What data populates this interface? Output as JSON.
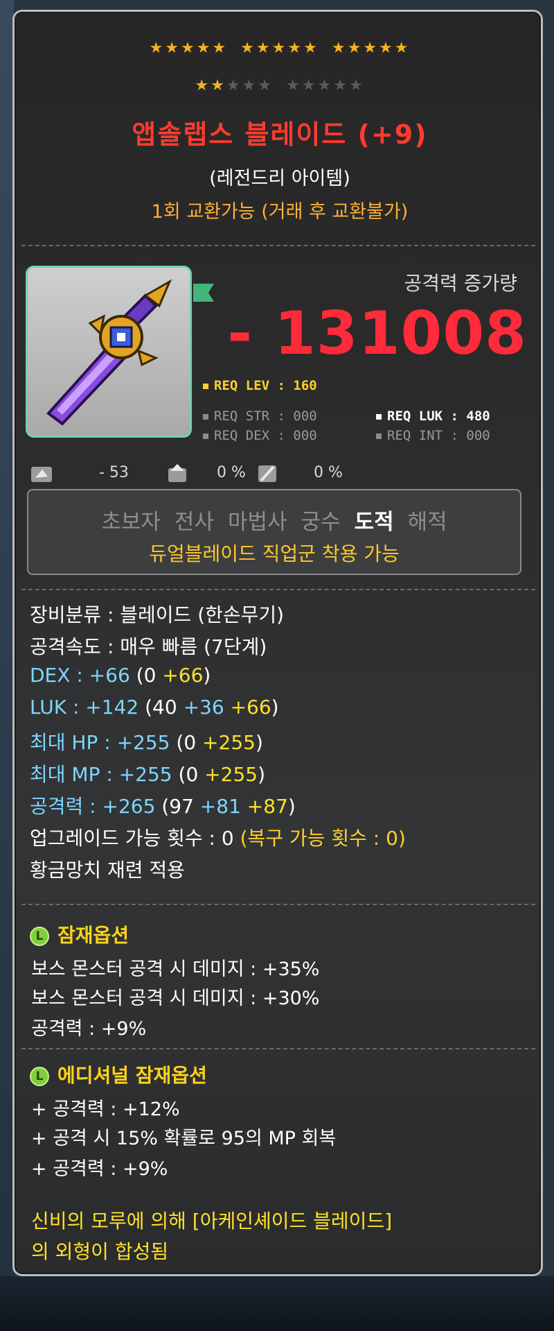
{
  "item": {
    "star_groups_row1": [
      5,
      5,
      5
    ],
    "star_row2": {
      "filled": 2,
      "empty_groups": [
        3,
        5
      ]
    },
    "name": "앱솔랩스 블레이드 (+9)",
    "grade": "(레전드리 아이템)",
    "trade": "1회 교환가능 (거래 후 교환불가)"
  },
  "attack_gain": {
    "label": "공격력 증가량",
    "value": "- 131008"
  },
  "requirements": {
    "lev": "REQ LEV : 160",
    "str": "REQ STR : 000",
    "dex": "REQ DEX : 000",
    "luk": "REQ LUK : 480",
    "int": "REQ INT : 000"
  },
  "small_stats": {
    "knockback": "- 53",
    "stat_two": "0 %",
    "stat_three": "0 %"
  },
  "jobs": {
    "list": [
      "초보자",
      "전사",
      "마법사",
      "궁수",
      "도적",
      "해적"
    ],
    "active_index": 4,
    "note": "듀얼블레이드 직업군 착용 가능"
  },
  "stats": {
    "category": "장비분류 : 블레이드 (한손무기)",
    "speed": "공격속도 : 매우 빠름 (7단계)",
    "dex": {
      "label": "DEX : +66",
      "open": " (",
      "a": "0",
      "b": " +66",
      "close": ")"
    },
    "luk": {
      "label": "LUK : +142",
      "open": " (",
      "a": "40",
      "b": " +36",
      "c": " +66",
      "close": ")"
    },
    "hp": {
      "label": "최대 HP : +255",
      "open": " (",
      "a": "0",
      "b": " +255",
      "close": ")"
    },
    "mp": {
      "label": "최대 MP : +255",
      "open": " (",
      "a": "0",
      "b": " +255",
      "close": ")"
    },
    "atk": {
      "label": "공격력 : +265",
      "open": " (",
      "a": "97",
      "b": " +81",
      "c": " +87",
      "close": ")"
    },
    "upgrade": "업그레이드 가능 횟수 : 0",
    "upgrade_restore": " (복구 가능 횟수 : 0)",
    "hammer": "황금망치 재련 적용"
  },
  "potential": {
    "title": "잠재옵션",
    "badge": "L",
    "lines": [
      "보스 몬스터 공격 시 데미지 : +35%",
      "보스 몬스터 공격 시 데미지 : +30%",
      "공격력 : +9%"
    ]
  },
  "additional": {
    "title": "에디셔널 잠재옵션",
    "badge": "L",
    "lines": [
      "+ 공격력 : +12%",
      "+ 공격 시 15% 확률로 95의 MP 회복",
      "+ 공격력 : +9%"
    ]
  },
  "fusion": {
    "line1": "신비의 모루에 의해 [아케인셰이드 블레이드]",
    "line2": "의 외형이 합성됨"
  },
  "colors": {
    "name": "#ff3b2e",
    "attack": "#ff2a3a",
    "star_on": "#f5b21c",
    "icon_border": "#6fd5a6",
    "stat_blue": "#7fd6ff",
    "stat_yellow": "#ffe22a"
  }
}
